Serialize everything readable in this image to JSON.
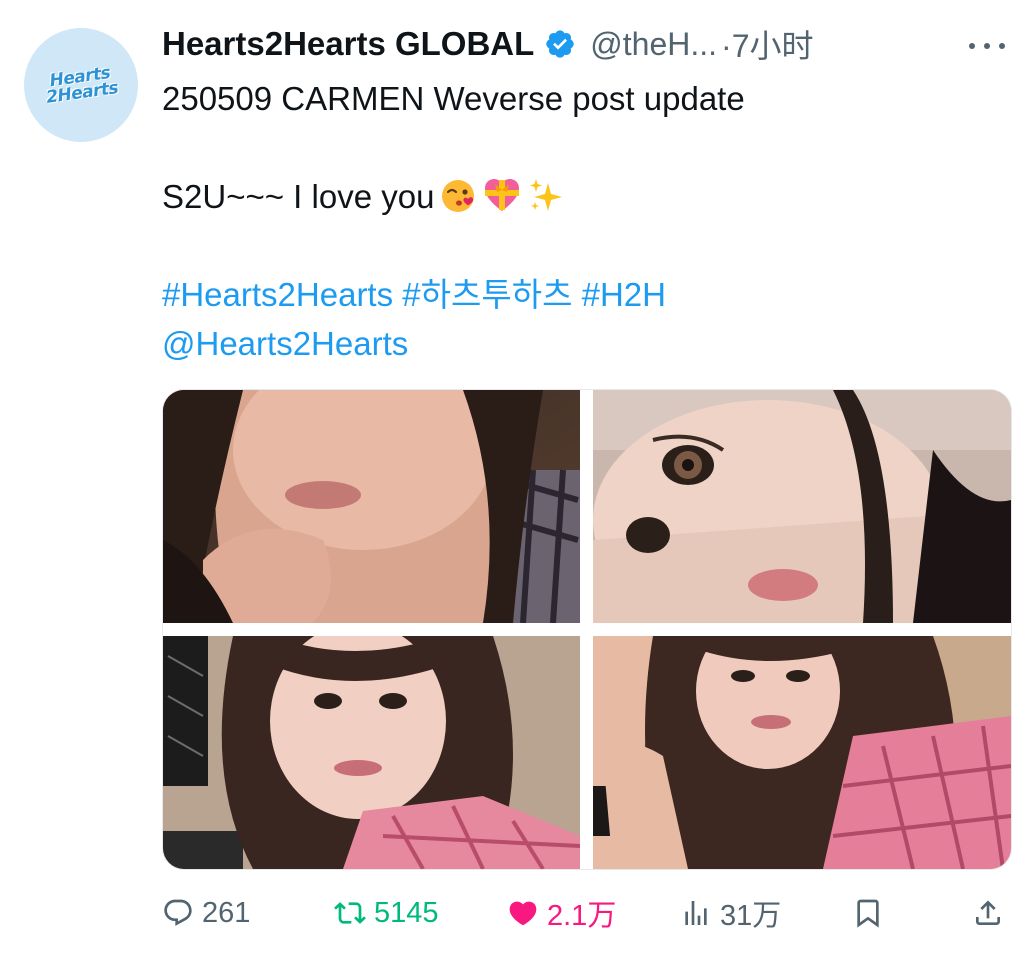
{
  "author": {
    "avatar_logo_line1": "Hearts",
    "avatar_logo_line2": "2Hearts",
    "display_name": "Hearts2Hearts GLOBAL",
    "handle": "@theH...",
    "time": "·7小时"
  },
  "tweet": {
    "line1": "250509 CARMEN Weverse post update",
    "line2_text": "S2U~~~ I love you",
    "hashtags": [
      "#Hearts2Hearts",
      "#하츠투하츠",
      "#H2H"
    ],
    "mention": "@Hearts2Hearts"
  },
  "media": {
    "photos": [
      "photo-1",
      "photo-2",
      "photo-3",
      "photo-4"
    ]
  },
  "actions": {
    "replies": "261",
    "reposts": "5145",
    "likes": "2.1万",
    "views": "31万"
  },
  "colors": {
    "link": "#1d9bf0",
    "verified": "#1d9bf0",
    "repost": "#00ba7c",
    "like": "#f91880",
    "secondary_text": "#536471",
    "avatar_bg": "#cfe7f6"
  },
  "icons": [
    "verified-badge-icon",
    "more-icon",
    "kiss-emoji-icon",
    "heart-ribbon-emoji-icon",
    "sparkles-emoji-icon",
    "reply-icon",
    "repost-icon",
    "like-icon",
    "views-icon",
    "bookmark-icon",
    "share-icon"
  ]
}
